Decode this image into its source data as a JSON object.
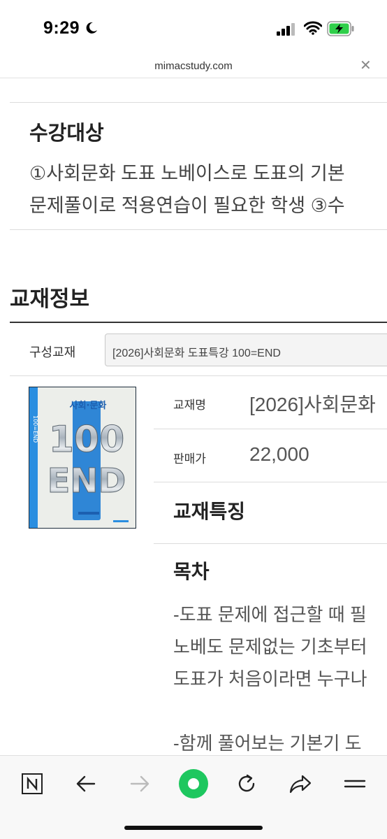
{
  "status_bar": {
    "time": "9:29"
  },
  "address_bar": {
    "url": "mimacstudy.com"
  },
  "target": {
    "heading": "수강대상",
    "lines": [
      "①사회문화 도표 노베이스로 도표의 기본",
      "문제풀이로 적용연습이 필요한 학생 ③수"
    ]
  },
  "book_info": {
    "heading": "교재정보",
    "compose_label": "구성교재",
    "compose_value": "[2026]사회문화 도표특강 100=END",
    "cover": {
      "subject": "사회·문화",
      "big_top": "100",
      "big_bottom": "END",
      "spine": "100=END"
    },
    "title_label": "교재명",
    "title_value": "[2026]사회문화",
    "price_label": "판매가",
    "price_value": "22,000",
    "feature_heading": "교재특징",
    "toc_heading": "목차",
    "toc_lines": [
      "-도표 문제에 접근할 때 필",
      "노베도 문제없는 기초부터",
      "도표가 처음이라면 누구나",
      "",
      "-함께 풀어보는 기본기 도"
    ]
  },
  "colors": {
    "accent_green": "#1ec75f",
    "cover_blue": "#1f7fd0"
  }
}
